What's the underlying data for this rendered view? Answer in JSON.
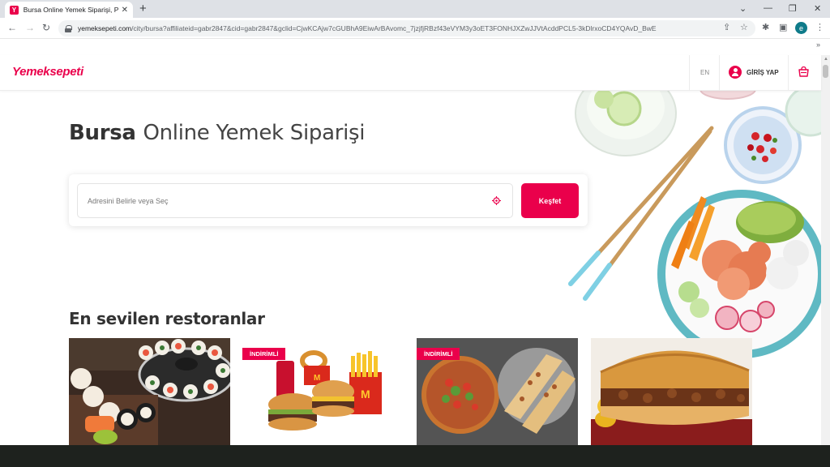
{
  "browser": {
    "tab_title": "Bursa Online Yemek Siparişi, Paket",
    "url_host": "yemeksepeti.com",
    "url_path": "/city/bursa?affiliateid=gabr2847&cid=gabr2847&gclid=CjwKCAjw7cGUBhA9EiwArBAvomc_7jzjfjRBzf43eVYM3y3oET3FONHJXZwJJVtAcddPCL5-3kDlrxoCD4YQAvD_BwE",
    "profile_initial": "e"
  },
  "header": {
    "logo": "Yemeksepeti",
    "lang": "EN",
    "login": "GİRİŞ YAP",
    "brand_color": "#ea004b"
  },
  "hero": {
    "title_bold": "Bursa",
    "title_rest": "Online Yemek Siparişi",
    "search_placeholder": "Adresini Belirle veya Seç",
    "search_button": "Keşfet"
  },
  "restaurants": {
    "title": "En sevilen restoranlar",
    "items": [
      {
        "image": "sushi-platter",
        "badge": ""
      },
      {
        "image": "mcdonalds-burgers",
        "badge": "İNDİRİMLİ"
      },
      {
        "image": "lahmacun-pide",
        "badge": "İNDİRİMLİ"
      },
      {
        "image": "sandwich",
        "badge": ""
      }
    ]
  }
}
